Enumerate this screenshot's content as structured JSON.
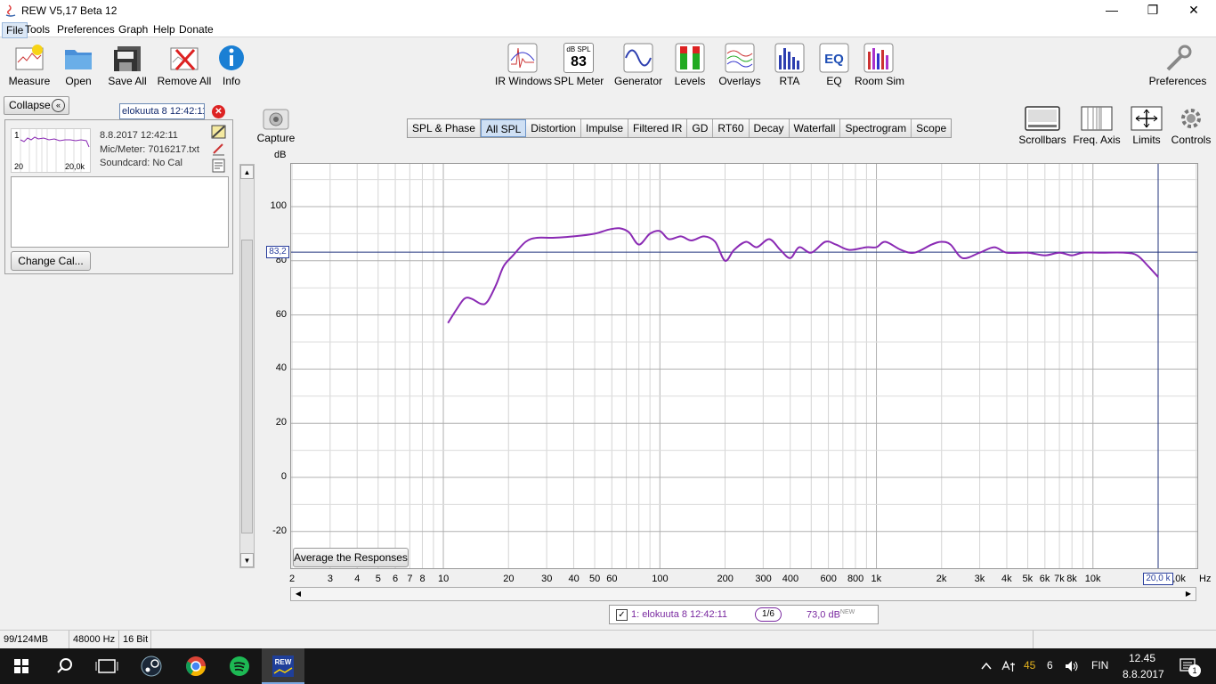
{
  "window": {
    "title": "REW V5,17 Beta 12",
    "minimize": "—",
    "maximize": "❐",
    "close": "✕"
  },
  "menu": [
    "File",
    "Tools",
    "Preferences",
    "Graph",
    "Help",
    "Donate"
  ],
  "toolbar_left": [
    {
      "label": "Measure",
      "icon": "measure-icon"
    },
    {
      "label": "Open",
      "icon": "folder-icon"
    },
    {
      "label": "Save All",
      "icon": "floppy-icon"
    },
    {
      "label": "Remove All",
      "icon": "remove-all-icon"
    },
    {
      "label": "Info",
      "icon": "info-icon"
    }
  ],
  "toolbar_center": [
    {
      "label": "IR Windows",
      "icon": "ir-windows-icon"
    },
    {
      "label": "SPL Meter",
      "icon": "spl-meter-icon",
      "top_text": "dB SPL",
      "value": "83"
    },
    {
      "label": "Generator",
      "icon": "generator-icon"
    },
    {
      "label": "Levels",
      "icon": "levels-icon"
    },
    {
      "label": "Overlays",
      "icon": "overlays-icon"
    },
    {
      "label": "RTA",
      "icon": "rta-icon"
    },
    {
      "label": "EQ",
      "icon": "eq-icon"
    },
    {
      "label": "Room Sim",
      "icon": "room-sim-icon"
    }
  ],
  "toolbar_right": {
    "preferences": "Preferences"
  },
  "graph_tools": [
    {
      "label": "Scrollbars",
      "icon": "scrollbars-icon"
    },
    {
      "label": "Freq. Axis",
      "icon": "freq-axis-icon"
    },
    {
      "label": "Limits",
      "icon": "limits-icon"
    },
    {
      "label": "Controls",
      "icon": "gear-icon"
    }
  ],
  "capture": {
    "label": "Capture"
  },
  "left_panel": {
    "collapse_label": "Collapse",
    "collapse_icon": "«",
    "measurement_name": "elokuuta 8 12:42:11",
    "close_icon": "✕",
    "thumb_index": "1",
    "thumb_x_min": "20",
    "thumb_x_max": "20,0k",
    "date": "8.8.2017 12:42:11",
    "mic": "Mic/Meter: 7016217.txt",
    "soundcard": "Soundcard: No Cal",
    "change_cal": "Change Cal..."
  },
  "tabs": [
    "SPL & Phase",
    "All SPL",
    "Distortion",
    "Impulse",
    "Filtered IR",
    "GD",
    "RT60",
    "Decay",
    "Waterfall",
    "Spectrogram",
    "Scope"
  ],
  "active_tab": "All SPL",
  "plot": {
    "y_unit": "dB",
    "x_unit": "Hz",
    "cursor_y": "83,2",
    "cursor_x": "20,0 k",
    "average_button": "Average the Responses",
    "y_ticks": [
      "100",
      "80",
      "60",
      "40",
      "20",
      "0",
      "-20"
    ],
    "x_ticks": [
      "2",
      "3",
      "4",
      "5",
      "6",
      "7",
      "8",
      "10",
      "20",
      "30",
      "40",
      "50",
      "60",
      "100",
      "200",
      "300",
      "400",
      "600",
      "800",
      "1k",
      "2k",
      "3k",
      "4k",
      "5k",
      "6k",
      "7k",
      "8k",
      "10k",
      "30,0k"
    ]
  },
  "chart_data": {
    "type": "line",
    "xscale": "log",
    "xlim": [
      2,
      30000
    ],
    "ylim": [
      -25,
      115
    ],
    "ylabel": "dB",
    "xlabel": "Hz",
    "grid": true,
    "cursor": {
      "x": 20000,
      "y": 83.2
    },
    "series": [
      {
        "name": "1: elokuuta 8 12:42:11",
        "color": "#8a2ab4",
        "points": [
          [
            10.5,
            57
          ],
          [
            11.5,
            62
          ],
          [
            12.5,
            66
          ],
          [
            13.5,
            66
          ],
          [
            15,
            64
          ],
          [
            16,
            65
          ],
          [
            17.5,
            71
          ],
          [
            19,
            78
          ],
          [
            21,
            82
          ],
          [
            24,
            87
          ],
          [
            27,
            88.5
          ],
          [
            32,
            88.5
          ],
          [
            40,
            89
          ],
          [
            50,
            90
          ],
          [
            58,
            91.5
          ],
          [
            65,
            92
          ],
          [
            72,
            90.5
          ],
          [
            80,
            86
          ],
          [
            90,
            90
          ],
          [
            100,
            91
          ],
          [
            110,
            88
          ],
          [
            125,
            89
          ],
          [
            140,
            87.5
          ],
          [
            160,
            89
          ],
          [
            180,
            87
          ],
          [
            200,
            80
          ],
          [
            220,
            84
          ],
          [
            250,
            87
          ],
          [
            280,
            85
          ],
          [
            320,
            88
          ],
          [
            360,
            84
          ],
          [
            400,
            81
          ],
          [
            440,
            85
          ],
          [
            500,
            83
          ],
          [
            580,
            87
          ],
          [
            650,
            86
          ],
          [
            750,
            84
          ],
          [
            900,
            85
          ],
          [
            1000,
            85
          ],
          [
            1100,
            87
          ],
          [
            1300,
            84
          ],
          [
            1500,
            83
          ],
          [
            1800,
            86
          ],
          [
            2000,
            87
          ],
          [
            2200,
            86
          ],
          [
            2500,
            81
          ],
          [
            3000,
            83
          ],
          [
            3500,
            85
          ],
          [
            4000,
            83
          ],
          [
            5000,
            83
          ],
          [
            6000,
            82
          ],
          [
            7000,
            83
          ],
          [
            8000,
            82
          ],
          [
            9000,
            83
          ],
          [
            11000,
            83
          ],
          [
            14000,
            83
          ],
          [
            16000,
            82
          ],
          [
            18000,
            78
          ],
          [
            20000,
            74
          ]
        ]
      }
    ]
  },
  "legend": {
    "checkbox": "✓",
    "label": "1: elokuuta 8 12:42:11",
    "smoothing": "1/6",
    "level": "73,0 dB",
    "level_sup": "NEW"
  },
  "statusbar": {
    "memory": "99/124MB",
    "rate": "48000 Hz",
    "bits": "16 Bit"
  },
  "taskbar": {
    "time": "12.45",
    "date": "8.8.2017",
    "lang": "FIN",
    "tray_num1": "45",
    "tray_num2": "6",
    "notif_count": "1"
  }
}
